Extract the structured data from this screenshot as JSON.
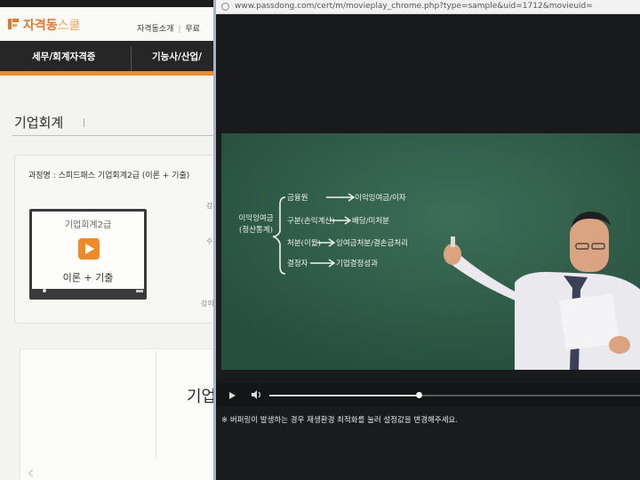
{
  "left_page": {
    "logo_main": "자격동",
    "logo_tail": "스쿨",
    "top_links": [
      "자격동소개",
      "무료"
    ],
    "nav": [
      "세무/회계자격증",
      "기능사/산업/"
    ],
    "page_title": "기업회계",
    "course_name": "과정명 : 스피드패스 기업회계2급 (이론 + 기출)",
    "thumb_title": "기업회계2급",
    "thumb_sub": "이론 + 기출",
    "side_fragments": [
      "강",
      "수",
      "강의"
    ],
    "lower_heading": "기업"
  },
  "popup": {
    "url": "www.passdong.com/cert/m/movieplay_chrome.php?type=sample&uid=1712&movieuid=",
    "notice": "※ 버퍼링이 발생하는 경우 재생환경 최적화를 눌러 설정값을 변경해주세요.",
    "progress": 0.4
  },
  "board": {
    "left_label": [
      "이익잉여금",
      "(정산통계)"
    ],
    "rows": [
      {
        "left": "금융원",
        "right": "이익잉여금/이자"
      },
      {
        "left": "구분(손익계산)",
        "right": "배당/미처분"
      },
      {
        "left": "처분(이월)",
        "right": "잉여금처분/결손금처리"
      },
      {
        "left": "결정자",
        "right": "기업결정성과"
      }
    ]
  },
  "colors": {
    "brand_orange": "#f08a24",
    "chalkboard": "#2f5d49",
    "nav_dark": "#262626"
  }
}
